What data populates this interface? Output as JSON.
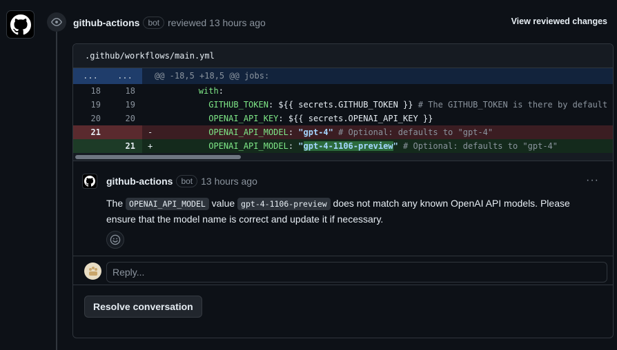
{
  "review": {
    "author": "github-actions",
    "bot_label": "bot",
    "action_text": "reviewed 13 hours ago",
    "view_changes_label": "View reviewed changes"
  },
  "file": {
    "path": ".github/workflows/main.yml"
  },
  "diff": {
    "hunk": {
      "left": "...",
      "right": "...",
      "text": "@@ -18,5 +18,5 @@ jobs:"
    },
    "rows": [
      {
        "old": "18",
        "new": "18",
        "sign": "",
        "indent": "        ",
        "key": "with",
        "rest": ":"
      },
      {
        "old": "19",
        "new": "19",
        "sign": "",
        "indent": "          ",
        "key": "GITHUB_TOKEN",
        "rest": ": ${{ secrets.GITHUB_TOKEN }} ",
        "comment": "# The GITHUB_TOKEN is there by default s"
      },
      {
        "old": "20",
        "new": "20",
        "sign": "",
        "indent": "          ",
        "key": "OPENAI_API_KEY",
        "rest": ": ${{ secrets.OPENAI_API_KEY }}"
      },
      {
        "old": "21",
        "new": "",
        "sign": "-",
        "indent": "          ",
        "key": "OPENAI_API_MODEL",
        "rest": ": ",
        "str": "\"gpt-4\"",
        "comment": " # Optional: defaults to \"gpt-4\""
      },
      {
        "old": "",
        "new": "21",
        "sign": "+",
        "indent": "          ",
        "key": "OPENAI_API_MODEL",
        "rest": ": ",
        "str_pre": "\"",
        "str_hl": "gpt-4-1106-preview",
        "str_post": "\"",
        "comment": " # Optional: defaults to \"gpt-4\""
      }
    ]
  },
  "comment": {
    "author": "github-actions",
    "bot_label": "bot",
    "time": "13 hours ago",
    "more_label": "···",
    "body_parts": {
      "p1": "The ",
      "code1": "OPENAI_API_MODEL",
      "p2": " value ",
      "code2": "gpt-4-1106-preview",
      "p3": " does not match any known OpenAI API models. Please ensure that the model name is correct and update it if necessary."
    }
  },
  "reply": {
    "placeholder": "Reply..."
  },
  "resolve": {
    "label": "Resolve conversation"
  },
  "colors": {
    "background": "#0d1117",
    "border": "#30363d",
    "deletion": "#3b1d22",
    "addition": "#142a1c",
    "hunk": "#12233c"
  },
  "icons": {
    "avatar": "github-mark-icon",
    "reviewed": "eye-icon",
    "emoji": "smiley-icon"
  }
}
